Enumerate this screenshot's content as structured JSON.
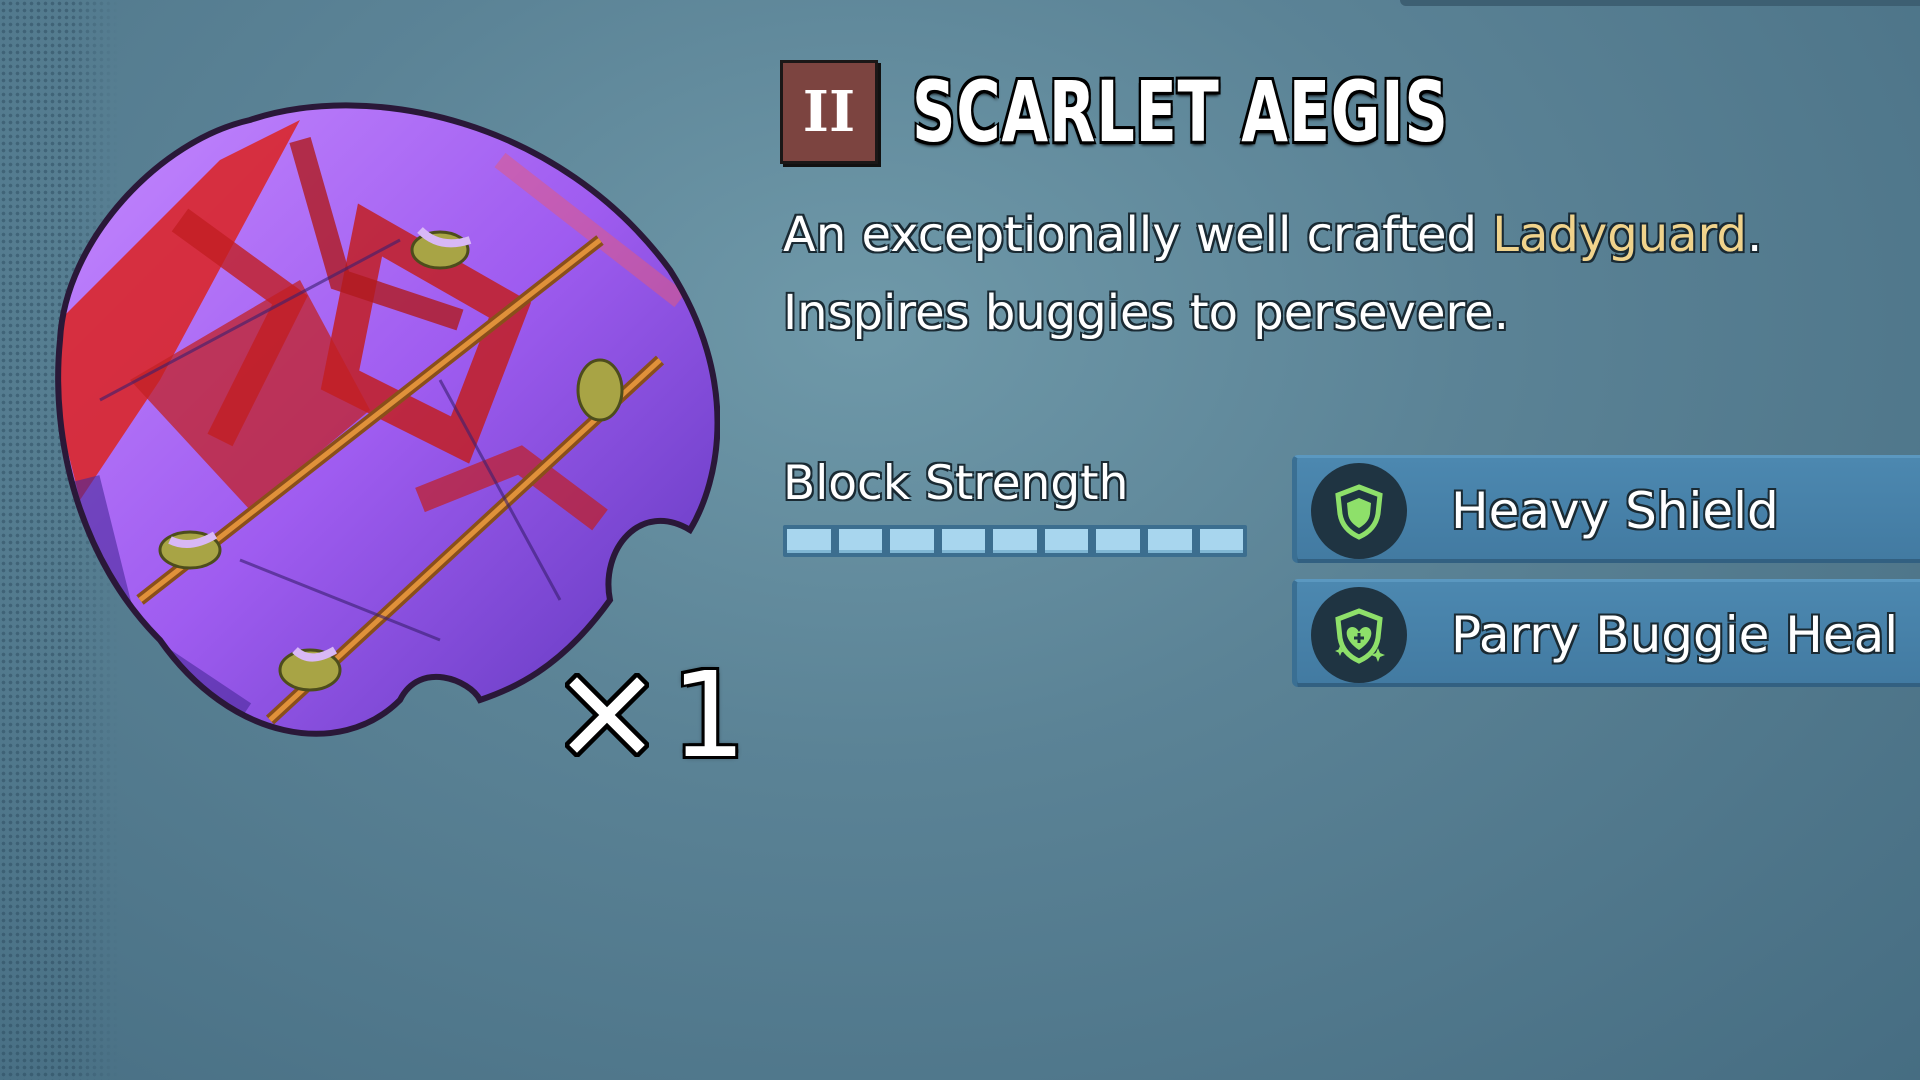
{
  "item": {
    "tier": "II",
    "name": "SCARLET AEGIS",
    "quantity": "1",
    "art_icon": "scarlet-aegis-shield-icon"
  },
  "description": {
    "prefix": "An exceptionally well crafted ",
    "highlight": "Ladyguard",
    "suffix": ".",
    "line2": "Inspires buggies to persevere."
  },
  "stats": [
    {
      "label": "Block Strength",
      "segments_filled": 9,
      "segments_total": 9
    }
  ],
  "perks": [
    {
      "label": "Heavy Shield",
      "icon": "heavy-shield-icon"
    },
    {
      "label": "Parry Buggie Heal",
      "icon": "parry-heal-icon"
    }
  ],
  "colors": {
    "background": "#5b8396",
    "highlight": "#f0d38c",
    "tier_badge": "#7c4440",
    "bar_fill": "#a8d6ee",
    "perk_panel": "#4c88b0",
    "perk_icon_green": "#8ee06a"
  }
}
